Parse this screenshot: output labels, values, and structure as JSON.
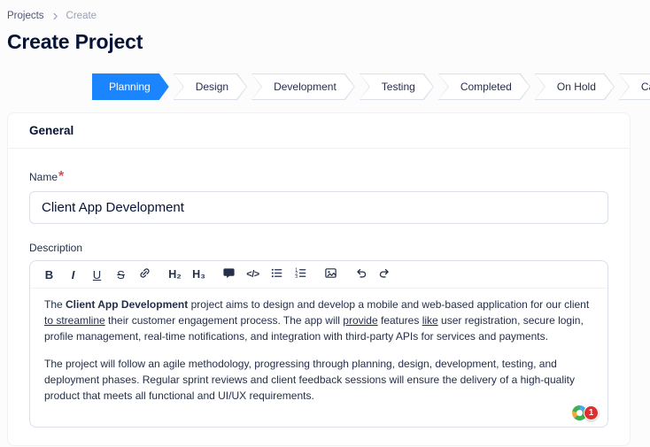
{
  "breadcrumb": {
    "items": [
      "Projects",
      "Create"
    ]
  },
  "page": {
    "title": "Create Project"
  },
  "stepper": {
    "steps": [
      {
        "label": "Planning",
        "active": true
      },
      {
        "label": "Design",
        "active": false
      },
      {
        "label": "Development",
        "active": false
      },
      {
        "label": "Testing",
        "active": false
      },
      {
        "label": "Completed",
        "active": false
      },
      {
        "label": "On Hold",
        "active": false
      },
      {
        "label": "Cancelled",
        "active": false
      }
    ]
  },
  "form": {
    "section_title": "General",
    "name": {
      "label": "Name",
      "required_mark": "*",
      "value": "Client App Development"
    },
    "description": {
      "label": "Description"
    }
  },
  "editor": {
    "toolbar": {
      "bold": "B",
      "italic": "I",
      "underline": "U",
      "strikethrough": "S",
      "h2": "H₂",
      "h3": "H₃",
      "code": "</>",
      "icons": [
        "link-icon",
        "comment-icon",
        "code-icon",
        "bullet-list-icon",
        "ordered-list-icon",
        "image-icon",
        "undo-icon",
        "redo-icon"
      ]
    },
    "p1": [
      {
        "t": "The ",
        "style": "normal"
      },
      {
        "t": "Client App Development",
        "style": "bold"
      },
      {
        "t": " project aims to design and develop a mobile and web-based application for our client ",
        "style": "normal"
      },
      {
        "t": "to streamline",
        "style": "underline"
      },
      {
        "t": " their customer engagement process. The app will ",
        "style": "normal"
      },
      {
        "t": "provide",
        "style": "underline"
      },
      {
        "t": " features ",
        "style": "normal"
      },
      {
        "t": "like",
        "style": "underline"
      },
      {
        "t": " user registration, secure login, profile management, real-time notifications, and integration with third-party APIs for services and payments.",
        "style": "normal"
      }
    ],
    "p2": "The project will follow an agile methodology, progressing through planning, design, development, testing, and deployment phases. Regular sprint reviews and client feedback sessions will ensure the delivery of a high-quality product that meets all functional and UI/UX requirements.",
    "grammar_badge_count": "1"
  },
  "colors": {
    "primary": "#1b84ff",
    "danger": "#e5484d",
    "badge_red": "#e02d2d",
    "grammar_green": "#3db24c",
    "text_dark": "#071437",
    "text_muted": "#99a1b7",
    "border": "#dbdfe9"
  }
}
